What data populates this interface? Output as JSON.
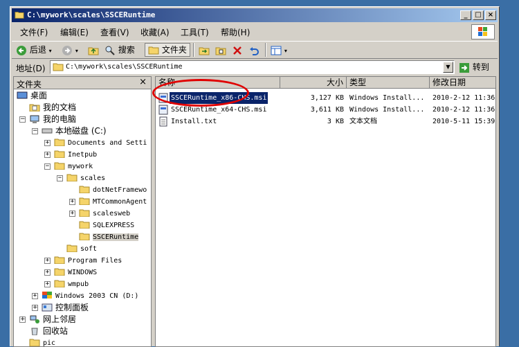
{
  "window": {
    "title": "C:\\mywork\\scales\\SSCERuntime"
  },
  "menubar": {
    "items": [
      "文件(F)",
      "编辑(E)",
      "查看(V)",
      "收藏(A)",
      "工具(T)",
      "帮助(H)"
    ]
  },
  "toolbar": {
    "back_label": "后退",
    "search_label": "搜索",
    "folders_label": "文件夹"
  },
  "address": {
    "label": "地址(D)",
    "value": "C:\\mywork\\scales\\SSCERuntime",
    "go_label": "转到"
  },
  "folders_panel": {
    "title": "文件夹",
    "items": [
      "桌面",
      "我的文档",
      "我的电脑",
      "本地磁盘 (C:)",
      "Documents and Setti",
      "Inetpub",
      "mywork",
      "scales",
      "dotNetFramewo",
      "MTCommonAgent",
      "scalesweb",
      "SQLEXPRESS",
      "SSCERuntime",
      "soft",
      "Program Files",
      "WINDOWS",
      "wmpub",
      "Windows 2003  CN (D:)",
      "控制面板",
      "网上邻居",
      "回收站",
      "pic"
    ]
  },
  "file_list": {
    "columns": [
      "名称",
      "大小",
      "类型",
      "修改日期"
    ],
    "rows": [
      {
        "name": "SSCERuntime_x86-CHS.msi",
        "size": "3,127 KB",
        "type": "Windows Install...",
        "date": "2010-2-12 11:36"
      },
      {
        "name": "SSCERuntime_x64-CHS.msi",
        "size": "3,611 KB",
        "type": "Windows Install...",
        "date": "2010-2-12 11:36"
      },
      {
        "name": "Install.txt",
        "size": "3 KB",
        "type": "文本文档",
        "date": "2010-5-11 15:39"
      }
    ]
  },
  "colors": {
    "title_active": "#0a246a",
    "annotation": "#e00000",
    "chrome": "#d4d0c8"
  }
}
